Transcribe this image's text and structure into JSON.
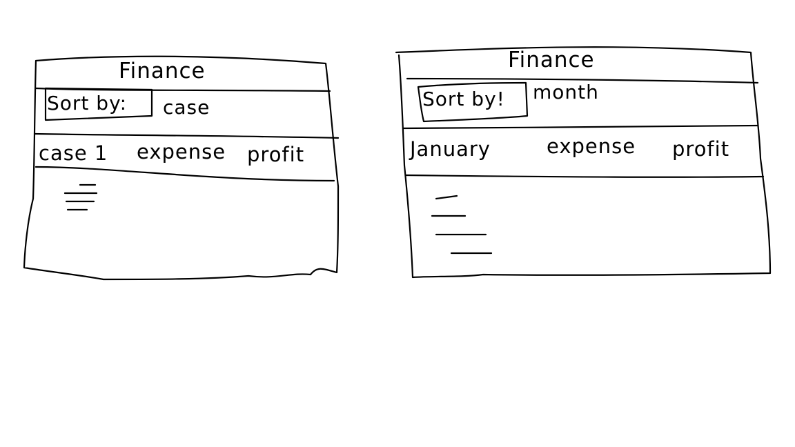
{
  "panels": [
    {
      "title": "Finance",
      "sort_label": "Sort by:",
      "sort_value": "case",
      "columns": [
        "case 1",
        "expense",
        "profit"
      ]
    },
    {
      "title": "Finance",
      "sort_label": "Sort by!",
      "sort_value": "month",
      "columns": [
        "January",
        "expense",
        "profit"
      ]
    }
  ]
}
